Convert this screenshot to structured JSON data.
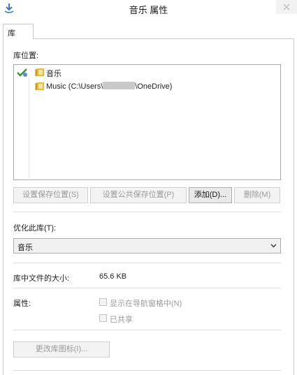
{
  "window": {
    "title": "音乐 属性"
  },
  "tabs": [
    {
      "label": "库"
    }
  ],
  "library": {
    "locations_label": "库位置:",
    "locations": [
      {
        "name": "音乐",
        "is_default": true
      },
      {
        "name_prefix": "Music (C:\\Users\\",
        "name_suffix": "\\OneDrive)",
        "has_redaction": true
      }
    ],
    "buttons": {
      "set_save": "设置保存位置(S)",
      "set_public_save": "设置公共保存位置(P)",
      "add": "添加(D)...",
      "remove": "删除(M)"
    },
    "optimize_label": "优化此库(T):",
    "optimize_value": "音乐",
    "size_label": "库中文件的大小:",
    "size_value": "65.6 KB",
    "attributes_label": "属性:",
    "show_in_nav": "显示在导航窗格中(N)",
    "shared": "已共享",
    "change_icon": "更改库图标(I)..."
  },
  "colors": {
    "folder": "#e7b93d",
    "default_mark": "#3c8f3a",
    "title_icon": "#3a7bc8"
  }
}
